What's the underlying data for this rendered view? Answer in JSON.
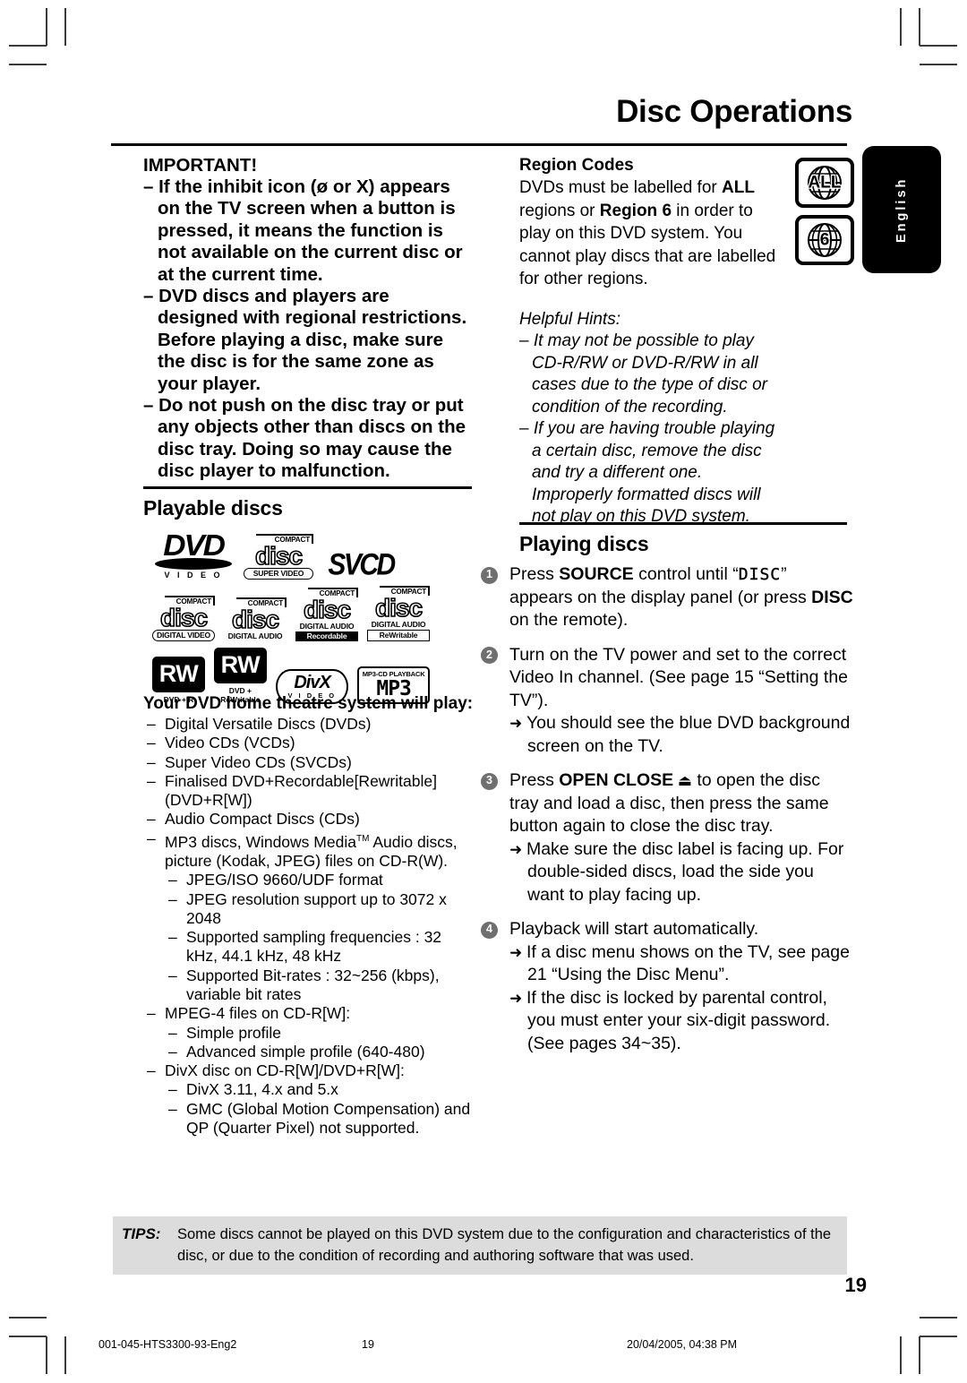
{
  "header": {
    "title": "Disc Operations",
    "language_tab": "English"
  },
  "left_column": {
    "important": {
      "heading": "IMPORTANT!",
      "paragraphs": [
        "– If the inhibit icon (ø or X) appears on the TV screen when a button is pressed, it means the function is not available on the current disc or at the current time.",
        "– DVD discs and players are designed with regional restrictions. Before playing a disc, make sure the disc is for the same zone as your player.",
        "– Do not push on the disc tray or put any objects other than discs on the disc tray.  Doing so may cause the disc player to malfunction."
      ]
    },
    "playable_discs": {
      "heading": "Playable discs",
      "logos": [
        {
          "name": "dvd-video-logo",
          "word": "DVD",
          "sub": "V I D E O"
        },
        {
          "name": "super-video-cd-logo",
          "top": "COMPACT",
          "mid": "disc",
          "sub": "SUPER VIDEO"
        },
        {
          "name": "svcd-logo",
          "word": "SVCD"
        },
        {
          "name": "cd-digital-video-logo",
          "top": "COMPACT",
          "mid": "disc",
          "sub": "DIGITAL VIDEO"
        },
        {
          "name": "cd-digital-audio-logo",
          "top": "COMPACT",
          "mid": "disc",
          "sub": "DIGITAL AUDIO"
        },
        {
          "name": "cd-recordable-logo",
          "top": "COMPACT",
          "mid": "disc",
          "sub": "DIGITAL AUDIO",
          "sub2": "Recordable"
        },
        {
          "name": "cd-rewritable-logo",
          "top": "COMPACT",
          "mid": "disc",
          "sub": "DIGITAL AUDIO",
          "sub2": "ReWritable"
        },
        {
          "name": "dvd-plus-r-logo",
          "box": "RW",
          "cap": "DVD + R"
        },
        {
          "name": "dvd-plus-rewritable-logo",
          "box": "RW",
          "cap": "DVD + ReWritable"
        },
        {
          "name": "divx-video-logo",
          "word": "DivX",
          "sub": "V I D E O"
        },
        {
          "name": "mp3-cd-playback-logo",
          "top": "MP3-CD PLAYBACK",
          "mid": "MP3"
        }
      ]
    },
    "play_list": {
      "heading": "Your DVD home theatre system will play:",
      "dash": "–",
      "items": [
        {
          "text": "Digital Versatile Discs (DVDs)"
        },
        {
          "text": "Video CDs (VCDs)"
        },
        {
          "text": "Super Video CDs (SVCDs)"
        },
        {
          "text": "Finalised DVD+Recordable[Rewritable] (DVD+R[W])"
        },
        {
          "text": "Audio Compact Discs (CDs)"
        },
        {
          "text_before_tm": "MP3 discs, Windows Media",
          "tm": "TM",
          "text_after_tm": " Audio discs, picture (Kodak, JPEG) files on CD-R(W).",
          "sub": [
            "JPEG/ISO 9660/UDF format",
            "JPEG resolution support up to 3072 x 2048",
            "Supported sampling frequencies : 32 kHz, 44.1 kHz, 48 kHz",
            "Supported Bit-rates : 32~256 (kbps), variable bit rates"
          ]
        },
        {
          "text": "MPEG-4 files on CD-R[W]:",
          "sub": [
            "Simple profile",
            "Advanced simple profile (640-480)"
          ]
        },
        {
          "text": "DivX disc on CD-R[W]/DVD+R[W]:",
          "sub": [
            "DivX 3.11, 4.x and 5.x",
            "GMC (Global Motion Compensation) and QP (Quarter Pixel) not supported."
          ]
        }
      ]
    }
  },
  "right_column": {
    "region_codes": {
      "heading": "Region Codes",
      "body_parts": [
        {
          "t": "DVDs must be labelled for ",
          "b": false
        },
        {
          "t": "ALL",
          "b": true
        },
        {
          "t": " regions or ",
          "b": false
        },
        {
          "t": "Region 6",
          "b": true
        },
        {
          "t": " in order to play on this DVD system. You cannot play discs that are labelled for other regions.",
          "b": false
        }
      ],
      "badges": [
        {
          "name": "region-all-badge",
          "label": "ALL"
        },
        {
          "name": "region-6-badge",
          "label": "6"
        }
      ]
    },
    "helpful_hints": {
      "heading": "Helpful Hints:",
      "items": [
        "– It may not be possible to play CD-R/RW or DVD-R/RW in all cases due to the type of disc or condition of the recording.",
        "– If you are having trouble playing a certain disc, remove the disc and try a different one. Improperly formatted discs will not play on this DVD system."
      ]
    },
    "playing_discs": {
      "heading": "Playing discs",
      "steps": [
        {
          "num": "1",
          "parts": [
            {
              "t": "Press ",
              "style": "normal"
            },
            {
              "t": "SOURCE",
              "style": "bold"
            },
            {
              "t": " control until “",
              "style": "normal"
            },
            {
              "t": "DISC",
              "style": "lcd"
            },
            {
              "t": "” appears on the display panel (or press ",
              "style": "normal"
            },
            {
              "t": "DISC",
              "style": "bold"
            },
            {
              "t": " on the remote).",
              "style": "normal"
            }
          ],
          "arrows": []
        },
        {
          "num": "2",
          "parts": [
            {
              "t": "Turn on the TV power and set to the correct Video In channel.  (See page 15 “Setting the TV”).",
              "style": "normal"
            }
          ],
          "arrows": [
            "You should see the blue DVD background screen on the TV."
          ]
        },
        {
          "num": "3",
          "parts": [
            {
              "t": "Press ",
              "style": "normal"
            },
            {
              "t": "OPEN CLOSE",
              "style": "bold"
            },
            {
              "t": " ⏏",
              "style": "eject"
            },
            {
              "t": " to open the disc tray and load a disc, then press the same button again to close the disc tray.",
              "style": "normal"
            }
          ],
          "arrows": [
            "Make sure the disc label is facing up. For double-sided discs, load the side you want to play facing up."
          ]
        },
        {
          "num": "4",
          "parts": [
            {
              "t": "Playback will start automatically.",
              "style": "normal"
            }
          ],
          "arrows": [
            "If a disc menu shows on the TV, see page 21 “Using the Disc Menu”.",
            "If the disc is locked by parental control, you must enter your six-digit password. (See pages 34~35)."
          ]
        }
      ],
      "arrow_glyph": "➜"
    }
  },
  "tips": {
    "label": "TIPS:",
    "text": "Some discs cannot be played on this DVD system due to the configuration and characteristics of the disc, or due to the condition of recording and authoring software that was used."
  },
  "page_number": "19",
  "footer": {
    "file": "001-045-HTS3300-93-Eng2",
    "page": "19",
    "timestamp": "20/04/2005, 04:38 PM"
  }
}
